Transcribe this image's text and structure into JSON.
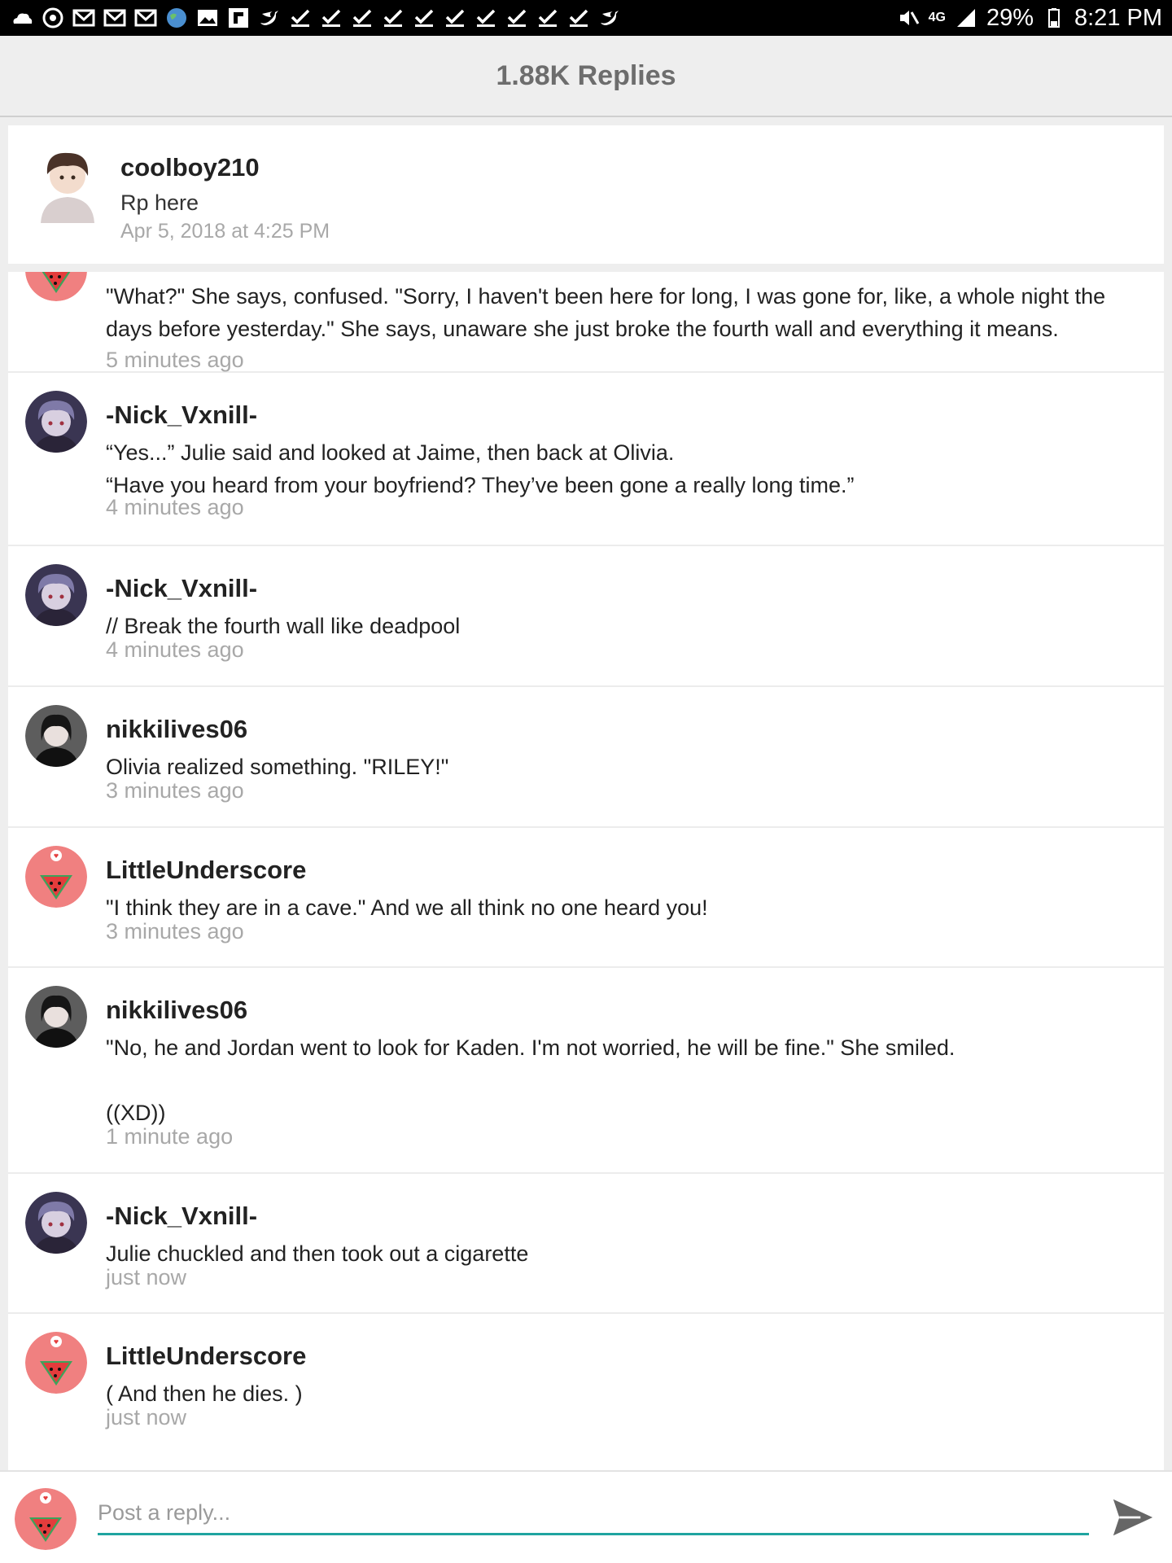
{
  "status_bar": {
    "icons": [
      "cloud-icon",
      "chrome-icon",
      "gmail-icon",
      "gmail-icon",
      "gmail-icon",
      "earth-icon",
      "gallery-icon",
      "flipboard-icon",
      "twitter-icon",
      "check-icon",
      "check-icon",
      "check-icon",
      "check-icon",
      "check-icon",
      "check-icon",
      "check-icon",
      "check-icon",
      "check-icon",
      "check-icon",
      "twitter-icon"
    ],
    "network": "4G",
    "battery": "29%",
    "time": "8:21 PM"
  },
  "header": {
    "title": "1.88K Replies"
  },
  "original_post": {
    "author": "coolboy210",
    "text": "Rp here",
    "date": "Apr 5, 2018 at 4:25 PM"
  },
  "replies": [
    {
      "author": "",
      "avatar": "watermelon-avatar",
      "body": "\"What?\" She says, confused. \"Sorry, I haven't been here for long, I was gone for, like, a whole night the days before yesterday.\" She says, unaware she just broke the fourth wall and everything it means.",
      "time": "5 minutes ago"
    },
    {
      "author": "-Nick_Vxnill-",
      "avatar": "purple-hair-avatar",
      "body": "“Yes...” Julie said and looked at Jaime, then back at Olivia.\n“Have you heard from your boyfriend? They’ve been gone a really long time.”",
      "time": "4 minutes ago"
    },
    {
      "author": "-Nick_Vxnill-",
      "avatar": "purple-hair-avatar",
      "body": "// Break the fourth wall like deadpool",
      "time": "4 minutes ago"
    },
    {
      "author": "nikkilives06",
      "avatar": "dark-hair-avatar",
      "body": "Olivia realized something. \"RILEY!\"",
      "time": "3 minutes ago"
    },
    {
      "author": "LittleUnderscore",
      "avatar": "watermelon-avatar",
      "body": "\"I think they are in a cave.\" And we all think no one heard you!",
      "time": "3 minutes ago"
    },
    {
      "author": "nikkilives06",
      "avatar": "dark-hair-avatar",
      "body": "\"No, he and Jordan went to look for Kaden. I'm not worried, he will be fine.\" She smiled.\n\n((XD))",
      "time": "1 minute ago"
    },
    {
      "author": "-Nick_Vxnill-",
      "avatar": "purple-hair-avatar",
      "body": "Julie chuckled and then took out a cigarette",
      "time": "just now"
    },
    {
      "author": "LittleUnderscore",
      "avatar": "watermelon-avatar",
      "body": "( And then he dies. )",
      "time": "just now"
    }
  ],
  "composer": {
    "placeholder": "Post a reply..."
  },
  "colors": {
    "accent": "#1fa4a0",
    "muted_text": "#a8a8a8",
    "watermelon_pink": "#f08080"
  }
}
